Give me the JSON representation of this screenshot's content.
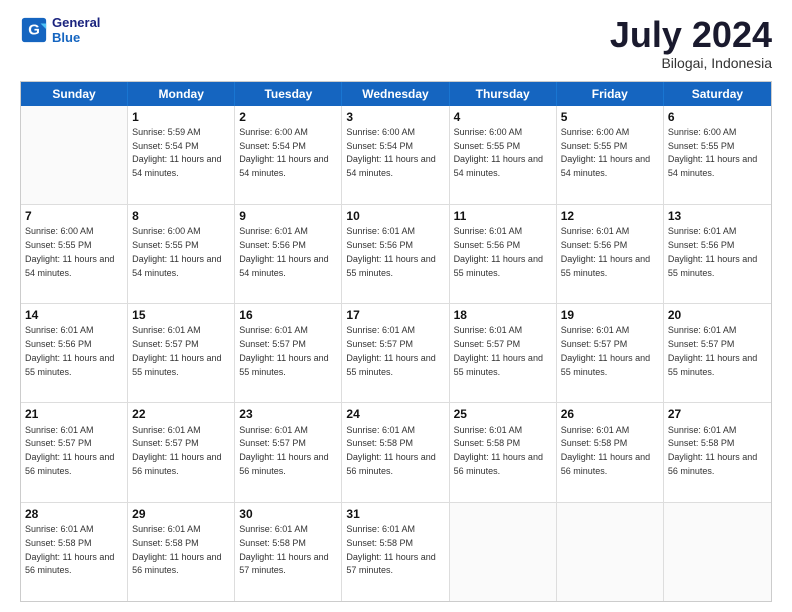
{
  "header": {
    "logo_line1": "General",
    "logo_line2": "Blue",
    "month": "July 2024",
    "location": "Bilogai, Indonesia"
  },
  "weekdays": [
    "Sunday",
    "Monday",
    "Tuesday",
    "Wednesday",
    "Thursday",
    "Friday",
    "Saturday"
  ],
  "weeks": [
    [
      {
        "day": "",
        "sunrise": "",
        "sunset": "",
        "daylight": ""
      },
      {
        "day": "1",
        "sunrise": "Sunrise: 5:59 AM",
        "sunset": "Sunset: 5:54 PM",
        "daylight": "Daylight: 11 hours and 54 minutes."
      },
      {
        "day": "2",
        "sunrise": "Sunrise: 6:00 AM",
        "sunset": "Sunset: 5:54 PM",
        "daylight": "Daylight: 11 hours and 54 minutes."
      },
      {
        "day": "3",
        "sunrise": "Sunrise: 6:00 AM",
        "sunset": "Sunset: 5:54 PM",
        "daylight": "Daylight: 11 hours and 54 minutes."
      },
      {
        "day": "4",
        "sunrise": "Sunrise: 6:00 AM",
        "sunset": "Sunset: 5:55 PM",
        "daylight": "Daylight: 11 hours and 54 minutes."
      },
      {
        "day": "5",
        "sunrise": "Sunrise: 6:00 AM",
        "sunset": "Sunset: 5:55 PM",
        "daylight": "Daylight: 11 hours and 54 minutes."
      },
      {
        "day": "6",
        "sunrise": "Sunrise: 6:00 AM",
        "sunset": "Sunset: 5:55 PM",
        "daylight": "Daylight: 11 hours and 54 minutes."
      }
    ],
    [
      {
        "day": "7",
        "sunrise": "Sunrise: 6:00 AM",
        "sunset": "Sunset: 5:55 PM",
        "daylight": "Daylight: 11 hours and 54 minutes."
      },
      {
        "day": "8",
        "sunrise": "Sunrise: 6:00 AM",
        "sunset": "Sunset: 5:55 PM",
        "daylight": "Daylight: 11 hours and 54 minutes."
      },
      {
        "day": "9",
        "sunrise": "Sunrise: 6:01 AM",
        "sunset": "Sunset: 5:56 PM",
        "daylight": "Daylight: 11 hours and 54 minutes."
      },
      {
        "day": "10",
        "sunrise": "Sunrise: 6:01 AM",
        "sunset": "Sunset: 5:56 PM",
        "daylight": "Daylight: 11 hours and 55 minutes."
      },
      {
        "day": "11",
        "sunrise": "Sunrise: 6:01 AM",
        "sunset": "Sunset: 5:56 PM",
        "daylight": "Daylight: 11 hours and 55 minutes."
      },
      {
        "day": "12",
        "sunrise": "Sunrise: 6:01 AM",
        "sunset": "Sunset: 5:56 PM",
        "daylight": "Daylight: 11 hours and 55 minutes."
      },
      {
        "day": "13",
        "sunrise": "Sunrise: 6:01 AM",
        "sunset": "Sunset: 5:56 PM",
        "daylight": "Daylight: 11 hours and 55 minutes."
      }
    ],
    [
      {
        "day": "14",
        "sunrise": "Sunrise: 6:01 AM",
        "sunset": "Sunset: 5:56 PM",
        "daylight": "Daylight: 11 hours and 55 minutes."
      },
      {
        "day": "15",
        "sunrise": "Sunrise: 6:01 AM",
        "sunset": "Sunset: 5:57 PM",
        "daylight": "Daylight: 11 hours and 55 minutes."
      },
      {
        "day": "16",
        "sunrise": "Sunrise: 6:01 AM",
        "sunset": "Sunset: 5:57 PM",
        "daylight": "Daylight: 11 hours and 55 minutes."
      },
      {
        "day": "17",
        "sunrise": "Sunrise: 6:01 AM",
        "sunset": "Sunset: 5:57 PM",
        "daylight": "Daylight: 11 hours and 55 minutes."
      },
      {
        "day": "18",
        "sunrise": "Sunrise: 6:01 AM",
        "sunset": "Sunset: 5:57 PM",
        "daylight": "Daylight: 11 hours and 55 minutes."
      },
      {
        "day": "19",
        "sunrise": "Sunrise: 6:01 AM",
        "sunset": "Sunset: 5:57 PM",
        "daylight": "Daylight: 11 hours and 55 minutes."
      },
      {
        "day": "20",
        "sunrise": "Sunrise: 6:01 AM",
        "sunset": "Sunset: 5:57 PM",
        "daylight": "Daylight: 11 hours and 55 minutes."
      }
    ],
    [
      {
        "day": "21",
        "sunrise": "Sunrise: 6:01 AM",
        "sunset": "Sunset: 5:57 PM",
        "daylight": "Daylight: 11 hours and 56 minutes."
      },
      {
        "day": "22",
        "sunrise": "Sunrise: 6:01 AM",
        "sunset": "Sunset: 5:57 PM",
        "daylight": "Daylight: 11 hours and 56 minutes."
      },
      {
        "day": "23",
        "sunrise": "Sunrise: 6:01 AM",
        "sunset": "Sunset: 5:57 PM",
        "daylight": "Daylight: 11 hours and 56 minutes."
      },
      {
        "day": "24",
        "sunrise": "Sunrise: 6:01 AM",
        "sunset": "Sunset: 5:58 PM",
        "daylight": "Daylight: 11 hours and 56 minutes."
      },
      {
        "day": "25",
        "sunrise": "Sunrise: 6:01 AM",
        "sunset": "Sunset: 5:58 PM",
        "daylight": "Daylight: 11 hours and 56 minutes."
      },
      {
        "day": "26",
        "sunrise": "Sunrise: 6:01 AM",
        "sunset": "Sunset: 5:58 PM",
        "daylight": "Daylight: 11 hours and 56 minutes."
      },
      {
        "day": "27",
        "sunrise": "Sunrise: 6:01 AM",
        "sunset": "Sunset: 5:58 PM",
        "daylight": "Daylight: 11 hours and 56 minutes."
      }
    ],
    [
      {
        "day": "28",
        "sunrise": "Sunrise: 6:01 AM",
        "sunset": "Sunset: 5:58 PM",
        "daylight": "Daylight: 11 hours and 56 minutes."
      },
      {
        "day": "29",
        "sunrise": "Sunrise: 6:01 AM",
        "sunset": "Sunset: 5:58 PM",
        "daylight": "Daylight: 11 hours and 56 minutes."
      },
      {
        "day": "30",
        "sunrise": "Sunrise: 6:01 AM",
        "sunset": "Sunset: 5:58 PM",
        "daylight": "Daylight: 11 hours and 57 minutes."
      },
      {
        "day": "31",
        "sunrise": "Sunrise: 6:01 AM",
        "sunset": "Sunset: 5:58 PM",
        "daylight": "Daylight: 11 hours and 57 minutes."
      },
      {
        "day": "",
        "sunrise": "",
        "sunset": "",
        "daylight": ""
      },
      {
        "day": "",
        "sunrise": "",
        "sunset": "",
        "daylight": ""
      },
      {
        "day": "",
        "sunrise": "",
        "sunset": "",
        "daylight": ""
      }
    ]
  ]
}
